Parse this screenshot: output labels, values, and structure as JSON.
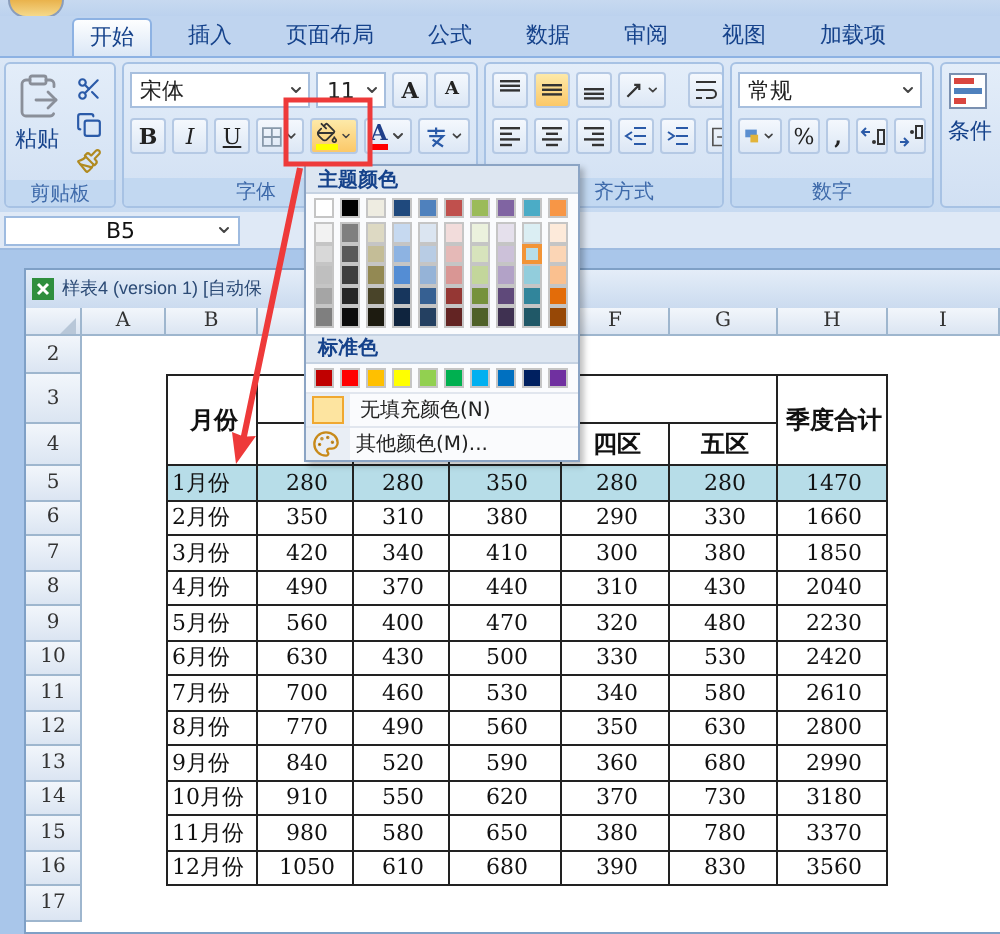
{
  "tabs": [
    {
      "label": "开始",
      "selected": true
    },
    {
      "label": "插入",
      "selected": false
    },
    {
      "label": "页面布局",
      "selected": false
    },
    {
      "label": "公式",
      "selected": false
    },
    {
      "label": "数据",
      "selected": false
    },
    {
      "label": "审阅",
      "selected": false
    },
    {
      "label": "视图",
      "selected": false
    },
    {
      "label": "加载项",
      "selected": false
    }
  ],
  "ribbon": {
    "clipboard": {
      "paste_label": "粘贴",
      "group_label": "剪贴板"
    },
    "font": {
      "font_name": "宋体",
      "font_size": "11",
      "grow_label": "A",
      "shrink_label": "A",
      "bold_label": "B",
      "italic_label": "I",
      "underline_label": "U",
      "font_color_label": "A",
      "group_label": "字体"
    },
    "alignment": {
      "vertical": [
        {
          "selected": false
        },
        {
          "selected": true
        },
        {
          "selected": false
        }
      ],
      "group_label": "齐方式"
    },
    "number": {
      "format": "常规",
      "percent_label": "%",
      "comma_label": ",",
      "group_label": "数字"
    },
    "styles": {
      "label": "条件"
    }
  },
  "name_box": "B5",
  "workbook": {
    "title": "样表4 (version 1) [自动保",
    "columns": [
      "A",
      "B",
      "F",
      "G",
      "H",
      "I"
    ],
    "row_numbers": [
      "2",
      "3",
      "4",
      "5",
      "6",
      "7",
      "8",
      "9",
      "10",
      "11",
      "12",
      "13",
      "14",
      "15",
      "16",
      "17"
    ],
    "table": {
      "month_header": "月份",
      "total_header": "季度合计",
      "region_headers": [
        "四区",
        "五区"
      ],
      "rows": [
        {
          "month": "1月份",
          "values": [
            "280",
            "280",
            "350",
            "280",
            "280",
            "1470"
          ],
          "highlighted": true
        },
        {
          "month": "2月份",
          "values": [
            "350",
            "310",
            "380",
            "290",
            "330",
            "1660"
          ],
          "highlighted": false
        },
        {
          "month": "3月份",
          "values": [
            "420",
            "340",
            "410",
            "300",
            "380",
            "1850"
          ],
          "highlighted": false
        },
        {
          "month": "4月份",
          "values": [
            "490",
            "370",
            "440",
            "310",
            "430",
            "2040"
          ],
          "highlighted": false
        },
        {
          "month": "5月份",
          "values": [
            "560",
            "400",
            "470",
            "320",
            "480",
            "2230"
          ],
          "highlighted": false
        },
        {
          "month": "6月份",
          "values": [
            "630",
            "430",
            "500",
            "330",
            "530",
            "2420"
          ],
          "highlighted": false
        },
        {
          "month": "7月份",
          "values": [
            "700",
            "460",
            "530",
            "340",
            "580",
            "2610"
          ],
          "highlighted": false
        },
        {
          "month": "8月份",
          "values": [
            "770",
            "490",
            "560",
            "350",
            "630",
            "2800"
          ],
          "highlighted": false
        },
        {
          "month": "9月份",
          "values": [
            "840",
            "520",
            "590",
            "360",
            "680",
            "2990"
          ],
          "highlighted": false
        },
        {
          "month": "10月份",
          "values": [
            "910",
            "550",
            "620",
            "370",
            "730",
            "3180"
          ],
          "highlighted": false
        },
        {
          "month": "11月份",
          "values": [
            "980",
            "580",
            "650",
            "380",
            "780",
            "3370"
          ],
          "highlighted": false
        },
        {
          "month": "12月份",
          "values": [
            "1050",
            "610",
            "680",
            "390",
            "830",
            "3560"
          ],
          "highlighted": false
        }
      ]
    }
  },
  "color_menu": {
    "theme_label": "主题颜色",
    "standard_label": "标准色",
    "no_fill_label": "无填充颜色(N)",
    "more_colors_label": "其他颜色(M)...",
    "theme_colors": [
      {
        "color": "#ffffff",
        "shades": [
          {
            "color": "#f2f2f2",
            "selected": false
          },
          {
            "color": "#d8d8d8",
            "selected": false
          },
          {
            "color": "#bfbfbf",
            "selected": false
          },
          {
            "color": "#a5a5a5",
            "selected": false
          },
          {
            "color": "#7f7f7f",
            "selected": false
          }
        ]
      },
      {
        "color": "#000000",
        "shades": [
          {
            "color": "#7f7f7f",
            "selected": false
          },
          {
            "color": "#595959",
            "selected": false
          },
          {
            "color": "#3f3f3f",
            "selected": false
          },
          {
            "color": "#262626",
            "selected": false
          },
          {
            "color": "#0c0c0c",
            "selected": false
          }
        ]
      },
      {
        "color": "#eeece1",
        "shades": [
          {
            "color": "#ddd9c3",
            "selected": false
          },
          {
            "color": "#c4bd97",
            "selected": false
          },
          {
            "color": "#938953",
            "selected": false
          },
          {
            "color": "#494429",
            "selected": false
          },
          {
            "color": "#1d1b10",
            "selected": false
          }
        ]
      },
      {
        "color": "#1f497d",
        "shades": [
          {
            "color": "#c6d9f0",
            "selected": false
          },
          {
            "color": "#8db3e2",
            "selected": false
          },
          {
            "color": "#548dd4",
            "selected": false
          },
          {
            "color": "#17365d",
            "selected": false
          },
          {
            "color": "#0f243e",
            "selected": false
          }
        ]
      },
      {
        "color": "#4f81bd",
        "shades": [
          {
            "color": "#dbe5f1",
            "selected": false
          },
          {
            "color": "#b8cce4",
            "selected": false
          },
          {
            "color": "#95b3d7",
            "selected": false
          },
          {
            "color": "#366092",
            "selected": false
          },
          {
            "color": "#244061",
            "selected": false
          }
        ]
      },
      {
        "color": "#c0504d",
        "shades": [
          {
            "color": "#f2dcdb",
            "selected": false
          },
          {
            "color": "#e5b9b7",
            "selected": false
          },
          {
            "color": "#d99694",
            "selected": false
          },
          {
            "color": "#953734",
            "selected": false
          },
          {
            "color": "#632423",
            "selected": false
          }
        ]
      },
      {
        "color": "#9bbb59",
        "shades": [
          {
            "color": "#ebf1dd",
            "selected": false
          },
          {
            "color": "#d7e3bc",
            "selected": false
          },
          {
            "color": "#c3d69b",
            "selected": false
          },
          {
            "color": "#76923c",
            "selected": false
          },
          {
            "color": "#4f6128",
            "selected": false
          }
        ]
      },
      {
        "color": "#8064a2",
        "shades": [
          {
            "color": "#e5e0ec",
            "selected": false
          },
          {
            "color": "#ccc1d9",
            "selected": false
          },
          {
            "color": "#b2a2c7",
            "selected": false
          },
          {
            "color": "#5f497a",
            "selected": false
          },
          {
            "color": "#3f3151",
            "selected": false
          }
        ]
      },
      {
        "color": "#4bacc6",
        "shades": [
          {
            "color": "#dbeef3",
            "selected": false
          },
          {
            "color": "#b7dde8",
            "selected": true
          },
          {
            "color": "#92cddc",
            "selected": false
          },
          {
            "color": "#31859b",
            "selected": false
          },
          {
            "color": "#205867",
            "selected": false
          }
        ]
      },
      {
        "color": "#f79646",
        "shades": [
          {
            "color": "#fdeada",
            "selected": false
          },
          {
            "color": "#fbd5b5",
            "selected": false
          },
          {
            "color": "#fac08f",
            "selected": false
          },
          {
            "color": "#e36c09",
            "selected": false
          },
          {
            "color": "#974806",
            "selected": false
          }
        ]
      }
    ],
    "standard_colors": [
      {
        "color": "#c00000"
      },
      {
        "color": "#ff0000"
      },
      {
        "color": "#ffc000"
      },
      {
        "color": "#ffff00"
      },
      {
        "color": "#92d050"
      },
      {
        "color": "#00b050"
      },
      {
        "color": "#00b0f0"
      },
      {
        "color": "#0070c0"
      },
      {
        "color": "#002060"
      },
      {
        "color": "#7030a0"
      }
    ]
  }
}
